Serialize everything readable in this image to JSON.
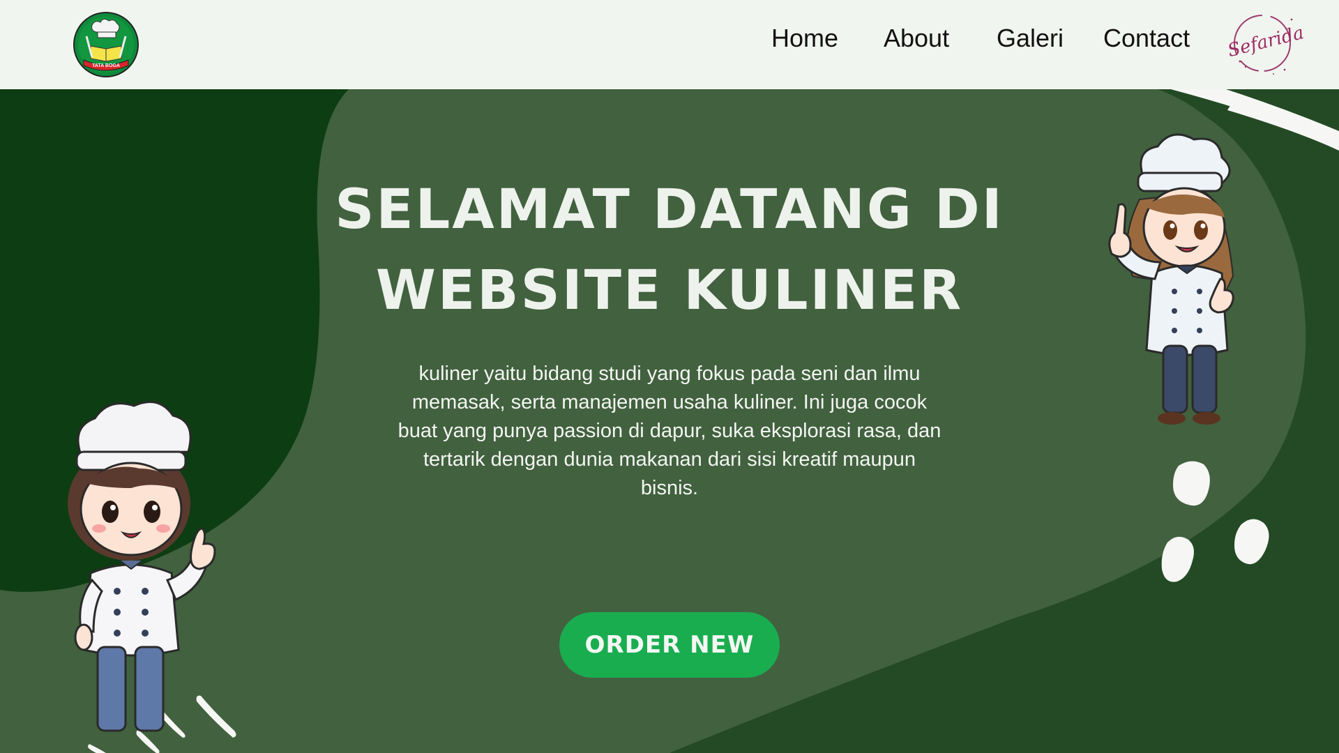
{
  "nav": {
    "logo_text": "TATA BOGA",
    "links": [
      {
        "label": "Home"
      },
      {
        "label": "About"
      },
      {
        "label": "Galeri"
      },
      {
        "label": "Contact"
      }
    ],
    "signature_text": "Sefarida"
  },
  "hero": {
    "title_line1": "SELAMAT DATANG DI",
    "title_line2": "WEBSITE KULINER",
    "description": "kuliner yaitu bidang studi yang fokus pada seni dan ilmu memasak, serta manajemen usaha kuliner. Ini juga cocok buat yang punya passion di dapur, suka eksplorasi rasa, dan tertarik dengan dunia makanan dari sisi kreatif maupun bisnis.",
    "cta_label": "ORDER NEW"
  },
  "colors": {
    "navbar_bg": "#f1f5ef",
    "hero_bg": "#42613f",
    "dark_green": "#0d3d12",
    "button": "#19ad50"
  },
  "icons": [
    "tata-boga-logo-icon",
    "signature-logo-icon",
    "chef-girl-left-illustration",
    "chef-girl-right-illustration"
  ]
}
